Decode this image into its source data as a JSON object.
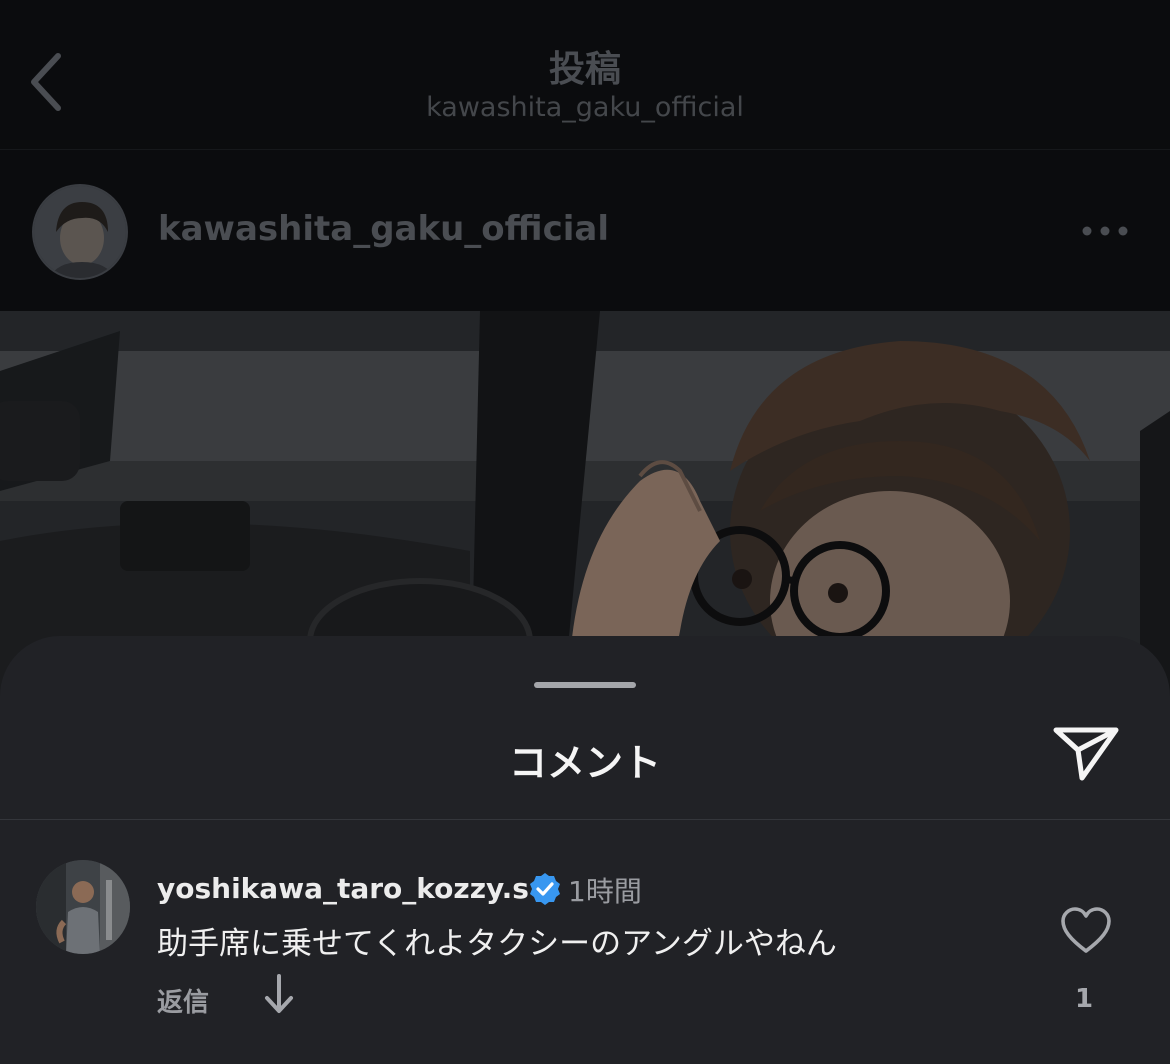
{
  "nav": {
    "title": "投稿",
    "subtitle": "kawashita_gaku_official",
    "back_icon": "chevron-left-icon"
  },
  "post": {
    "author": "kawashita_gaku_official",
    "more_icon": "ellipsis-icon"
  },
  "comments_sheet": {
    "title": "コメント",
    "share_icon": "paper-plane-icon"
  },
  "comments": [
    {
      "username": "yoshikawa_taro_kozzy.s",
      "verified": true,
      "time": "1時間",
      "text": "助手席に乗せてくれよタクシーのアングルやねん",
      "reply_label": "返信",
      "like_count": "1"
    }
  ],
  "colors": {
    "sheet_bg": "#212226",
    "verified_blue": "#3897f0",
    "dimmed_bg": "#0b0c0e"
  }
}
